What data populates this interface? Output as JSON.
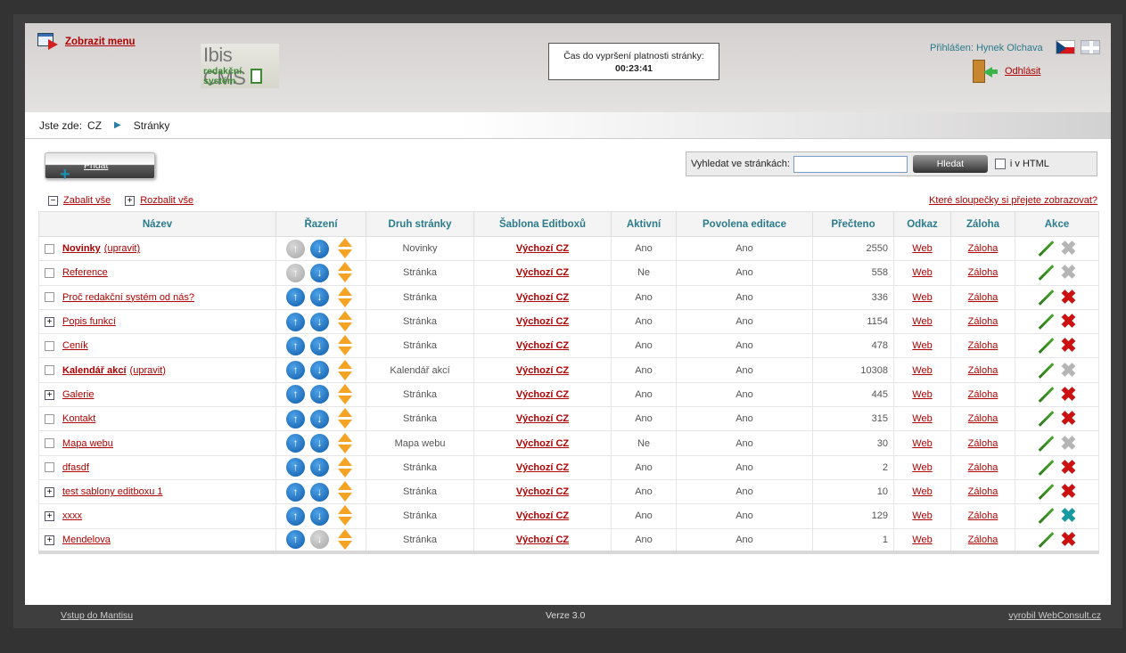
{
  "header": {
    "menu_label": "Zobrazit menu",
    "logo_title": "Ibis CMS",
    "logo_subtitle": "redakční systém",
    "timer_label": "Čas do vypršení platnosti stránky:",
    "timer_value": "00:23:41",
    "logged_in": "Přihlášen: Hynek Olchava",
    "logout_label": "Odhlásit",
    "languages": [
      "CZ",
      "EN"
    ]
  },
  "breadcrumb": {
    "prefix": "Jste zde:",
    "items": [
      "CZ",
      "Stránky"
    ]
  },
  "toolbar": {
    "add_label": "Přidat",
    "search_label": "Vyhledat ve stránkách:",
    "search_value": "",
    "search_button": "Hledat",
    "search_html_label": "i v HTML",
    "collapse_all": "Zabalit vše",
    "expand_all": "Rozbalit vše",
    "columns_link": "Které sloupečky si přejete zobrazovat?"
  },
  "table": {
    "columns": [
      "Název",
      "Řazení",
      "Druh stránky",
      "Šablona Editboxů",
      "Aktivní",
      "Povolena editace",
      "Přečteno",
      "Odkaz",
      "Záloha",
      "Akce"
    ],
    "edit_label": "(upravit)",
    "rows": [
      {
        "name": "Novinky",
        "bold": true,
        "editable": true,
        "expandable": false,
        "up": false,
        "down": true,
        "type": "Novinky",
        "template": "Výchozí CZ",
        "active": "Ano",
        "edit_allowed": "Ano",
        "reads": "2550",
        "link": "Web",
        "backup": "Záloha",
        "delete": "off"
      },
      {
        "name": "Reference",
        "bold": false,
        "editable": false,
        "expandable": false,
        "up": false,
        "down": true,
        "type": "Stránka",
        "template": "Výchozí CZ",
        "active": "Ne",
        "edit_allowed": "Ano",
        "reads": "558",
        "link": "Web",
        "backup": "Záloha",
        "delete": "off"
      },
      {
        "name": "Proč redakční systém od nás?",
        "bold": false,
        "editable": false,
        "expandable": false,
        "up": true,
        "down": true,
        "type": "Stránka",
        "template": "Výchozí CZ",
        "active": "Ano",
        "edit_allowed": "Ano",
        "reads": "336",
        "link": "Web",
        "backup": "Záloha",
        "delete": "on"
      },
      {
        "name": "Popis funkcí",
        "bold": false,
        "editable": false,
        "expandable": true,
        "up": true,
        "down": true,
        "type": "Stránka",
        "template": "Výchozí CZ",
        "active": "Ano",
        "edit_allowed": "Ano",
        "reads": "1154",
        "link": "Web",
        "backup": "Záloha",
        "delete": "on"
      },
      {
        "name": "Ceník",
        "bold": false,
        "editable": false,
        "expandable": false,
        "up": true,
        "down": true,
        "type": "Stránka",
        "template": "Výchozí CZ",
        "active": "Ano",
        "edit_allowed": "Ano",
        "reads": "478",
        "link": "Web",
        "backup": "Záloha",
        "delete": "on"
      },
      {
        "name": "Kalendář akcí",
        "bold": true,
        "editable": true,
        "expandable": false,
        "up": true,
        "down": true,
        "type": "Kalendář akcí",
        "template": "Výchozí CZ",
        "active": "Ano",
        "edit_allowed": "Ano",
        "reads": "10308",
        "link": "Web",
        "backup": "Záloha",
        "delete": "off"
      },
      {
        "name": "Galerie",
        "bold": false,
        "editable": false,
        "expandable": true,
        "up": true,
        "down": true,
        "type": "Stránka",
        "template": "Výchozí CZ",
        "active": "Ano",
        "edit_allowed": "Ano",
        "reads": "445",
        "link": "Web",
        "backup": "Záloha",
        "delete": "on"
      },
      {
        "name": "Kontakt",
        "bold": false,
        "editable": false,
        "expandable": false,
        "up": true,
        "down": true,
        "type": "Stránka",
        "template": "Výchozí CZ",
        "active": "Ano",
        "edit_allowed": "Ano",
        "reads": "315",
        "link": "Web",
        "backup": "Záloha",
        "delete": "on"
      },
      {
        "name": "Mapa webu",
        "bold": false,
        "editable": false,
        "expandable": false,
        "up": true,
        "down": true,
        "type": "Mapa webu",
        "template": "Výchozí CZ",
        "active": "Ne",
        "edit_allowed": "Ano",
        "reads": "30",
        "link": "Web",
        "backup": "Záloha",
        "delete": "off"
      },
      {
        "name": "dfasdf",
        "bold": false,
        "editable": false,
        "expandable": false,
        "up": true,
        "down": true,
        "type": "Stránka",
        "template": "Výchozí CZ",
        "active": "Ano",
        "edit_allowed": "Ano",
        "reads": "2",
        "link": "Web",
        "backup": "Záloha",
        "delete": "on"
      },
      {
        "name": "test sablony editboxu 1",
        "bold": false,
        "editable": false,
        "expandable": true,
        "up": true,
        "down": true,
        "type": "Stránka",
        "template": "Výchozí CZ",
        "active": "Ano",
        "edit_allowed": "Ano",
        "reads": "10",
        "link": "Web",
        "backup": "Záloha",
        "delete": "on"
      },
      {
        "name": "xxxx",
        "bold": false,
        "editable": false,
        "expandable": true,
        "up": true,
        "down": true,
        "type": "Stránka",
        "template": "Výchozí CZ",
        "active": "Ano",
        "edit_allowed": "Ano",
        "reads": "129",
        "link": "Web",
        "backup": "Záloha",
        "delete": "teal"
      },
      {
        "name": "Mendelova",
        "bold": false,
        "editable": false,
        "expandable": true,
        "up": true,
        "down": false,
        "type": "Stránka",
        "template": "Výchozí CZ",
        "active": "Ano",
        "edit_allowed": "Ano",
        "reads": "1",
        "link": "Web",
        "backup": "Záloha",
        "delete": "on"
      }
    ]
  },
  "footer": {
    "left": "Vstup do Mantisu",
    "center": "Verze 3.0",
    "right": "vyrobil WebConsult.cz"
  }
}
